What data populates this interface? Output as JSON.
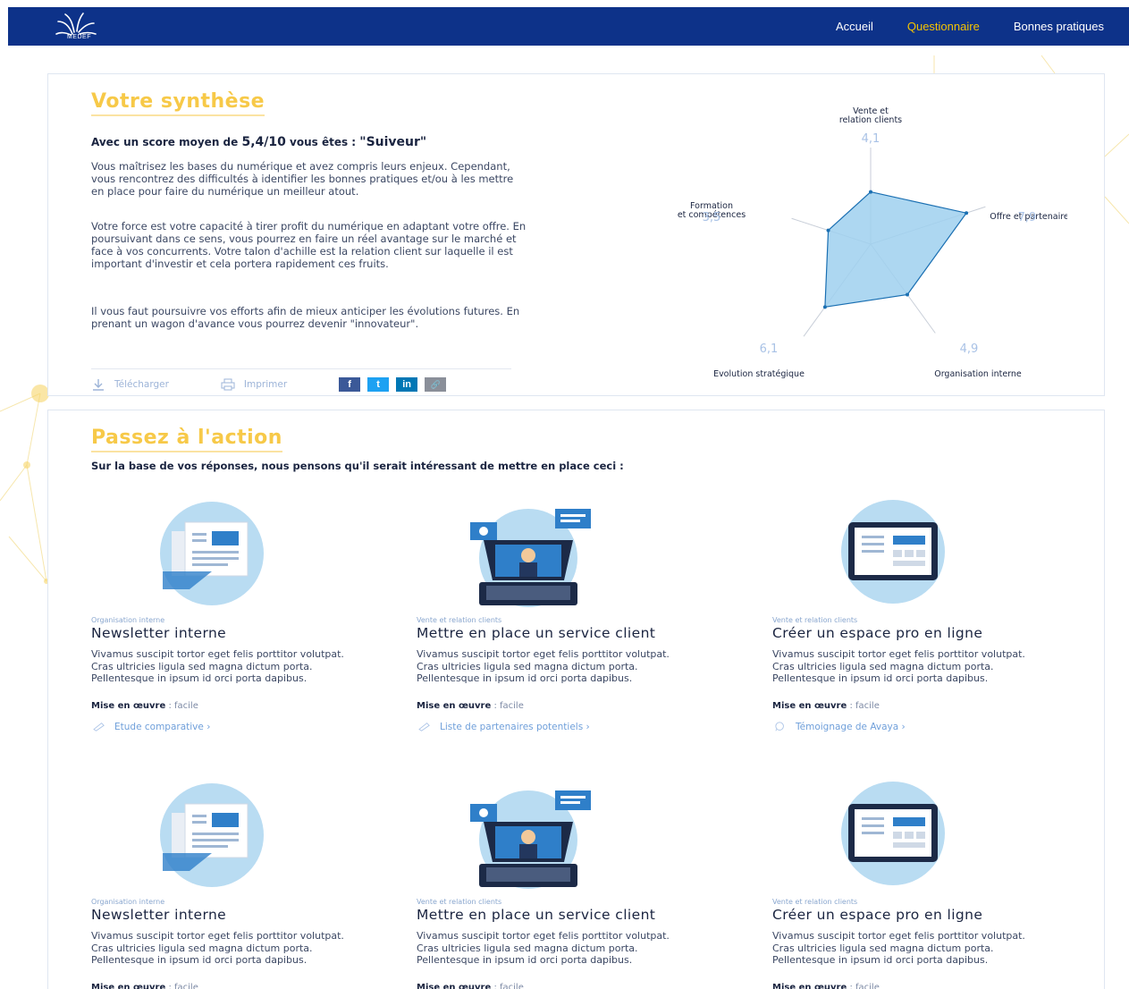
{
  "header": {
    "logo_text": "MEDEF",
    "nav": [
      {
        "label": "Accueil",
        "active": false
      },
      {
        "label": "Questionnaire",
        "active": true
      },
      {
        "label": "Bonnes pratiques",
        "active": false
      }
    ],
    "bg_color": "#0d3289",
    "active_color": "#f5c400"
  },
  "synthese": {
    "title": "Votre synthèse",
    "score_prefix": "Avec un score moyen de ",
    "score_value": "5,4/10",
    "score_middle": " vous êtes : ",
    "profile": "\"Suiveur\"",
    "paragraphs": [
      "Vous maîtrisez les bases du numérique et avez compris leurs enjeux. Cependant, vous rencontrez des difficultés à identifier les bonnes pratiques et/ou à les mettre en place pour faire du numérique un meilleur atout.",
      "Votre force est votre capacité à tirer profit du numérique en adaptant votre offre. En poursuivant dans ce sens, vous pourrez en faire un réel avantage sur le marché et face à vos concurrents. Votre talon d'achille est la relation client sur laquelle il est important d'investir et cela portera rapidement ces fruits.",
      "Il vous faut poursuivre vos efforts afin de mieux anticiper les évolutions futures. En prenant un wagon d'avance vous pourrez devenir \"innovateur\"."
    ],
    "actions": {
      "download": "Télécharger",
      "print": "Imprimer"
    },
    "share": [
      {
        "icon": "facebook-icon",
        "glyph": "f",
        "color": "#3b5998"
      },
      {
        "icon": "twitter-icon",
        "glyph": "t",
        "color": "#1da1f2"
      },
      {
        "icon": "linkedin-icon",
        "glyph": "in",
        "color": "#0077b5"
      },
      {
        "icon": "link-icon",
        "glyph": "🔗",
        "color": "#8a8f99"
      }
    ]
  },
  "chart_data": {
    "type": "radar",
    "range": [
      0,
      10
    ],
    "axes": [
      {
        "label_lines": [
          "Vente et",
          "relation clients"
        ],
        "value": 4.1,
        "display": "4,1"
      },
      {
        "label_lines": [
          "Offre et partenaires"
        ],
        "value": 7.9,
        "display": "7,9"
      },
      {
        "label_lines": [
          "Organisation interne"
        ],
        "value": 4.9,
        "display": "4,9"
      },
      {
        "label_lines": [
          "Evolution stratégique"
        ],
        "value": 6.1,
        "display": "6,1"
      },
      {
        "label_lines": [
          "Formation",
          "et compétences"
        ],
        "value": 3.5,
        "display": "3,5"
      }
    ],
    "fill_color": "#9fd0ee",
    "stroke_color": "#1a6fb2",
    "value_color": "#a9c2e6"
  },
  "action": {
    "title": "Passez à l'action",
    "intro": "Sur la base de vos réponses, nous pensons qu'il serait intéressant de mettre en place ceci :",
    "tiles": [
      {
        "category": "Organisation interne",
        "title": "Newsletter interne",
        "desc": "Vivamus suscipit tortor eget felis porttitor volutpat. Cras ultricies ligula sed magna dictum porta. Pellentesque in ipsum id orci porta dapibus.",
        "mise_label": "Mise en œuvre",
        "mise_value": " : facile",
        "link": "Etude comparative",
        "illu": "newsletter",
        "link_icon": "pencil-icon"
      },
      {
        "category": "Vente et relation clients",
        "title": "Mettre en place un service client",
        "desc": "Vivamus suscipit tortor eget felis porttitor volutpat. Cras ultricies ligula sed magna dictum porta. Pellentesque in ipsum id orci porta dapibus.",
        "mise_label": "Mise en œuvre",
        "mise_value": " : facile",
        "link": "Liste de partenaires potentiels",
        "illu": "service",
        "link_icon": "pencil-icon"
      },
      {
        "category": "Vente et relation clients",
        "title": "Créer un espace pro en ligne",
        "desc": "Vivamus suscipit tortor eget felis porttitor volutpat. Cras ultricies ligula sed magna dictum porta. Pellentesque in ipsum id orci porta dapibus.",
        "mise_label": "Mise en œuvre",
        "mise_value": " : facile",
        "link": "Témoignage de Avaya",
        "illu": "espace",
        "link_icon": "comment-icon"
      },
      {
        "category": "Organisation interne",
        "title": "Newsletter interne",
        "desc": "Vivamus suscipit tortor eget felis porttitor volutpat. Cras ultricies ligula sed magna dictum porta. Pellentesque in ipsum id orci porta dapibus.",
        "mise_label": "Mise en œuvre",
        "mise_value": " : facile",
        "link": "",
        "illu": "newsletter",
        "link_icon": ""
      },
      {
        "category": "Vente et relation clients",
        "title": "Mettre en place un service client",
        "desc": "Vivamus suscipit tortor eget felis porttitor volutpat. Cras ultricies ligula sed magna dictum porta. Pellentesque in ipsum id orci porta dapibus.",
        "mise_label": "Mise en œuvre",
        "mise_value": " : facile",
        "link": "",
        "illu": "service",
        "link_icon": ""
      },
      {
        "category": "Vente et relation clients",
        "title": "Créer un espace pro en ligne",
        "desc": "Vivamus suscipit tortor eget felis porttitor volutpat. Cras ultricies ligula sed magna dictum porta. Pellentesque in ipsum id orci porta dapibus.",
        "mise_label": "Mise en œuvre",
        "mise_value": " : facile",
        "link": "",
        "illu": "espace",
        "link_icon": ""
      }
    ]
  }
}
